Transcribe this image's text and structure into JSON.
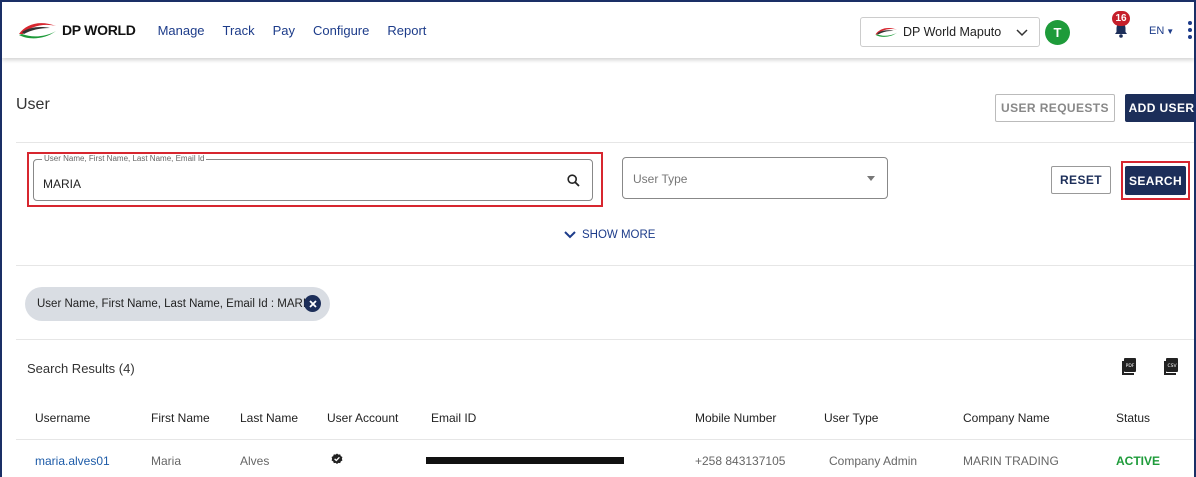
{
  "brand": {
    "logo_text": "DP WORLD",
    "accent": "#1c2e59",
    "logo_red": "#d7262f",
    "logo_green": "#1e9b3a"
  },
  "nav": {
    "items": [
      "Manage",
      "Track",
      "Pay",
      "Configure",
      "Report"
    ]
  },
  "header": {
    "site_select": "DP World Maputo",
    "avatar_initial": "T",
    "notification_count": "16",
    "language": "EN"
  },
  "page": {
    "title": "User",
    "user_requests_label": "USER REQUESTS",
    "add_user_label": "ADD USER"
  },
  "search": {
    "field_label": "User Name, First Name, Last Name, Email Id",
    "field_value": "MARIA",
    "user_type_placeholder": "User Type",
    "reset_label": "RESET",
    "search_label": "SEARCH",
    "show_more_label": "SHOW MORE"
  },
  "filter_chip": {
    "text": "User Name, First Name, Last Name, Email Id : MARIA"
  },
  "results": {
    "title": "Search Results (4)",
    "columns": [
      "Username",
      "First Name",
      "Last Name",
      "User Account",
      "Email ID",
      "Mobile Number",
      "User Type",
      "Company Name",
      "Status"
    ],
    "rows": [
      {
        "username": "maria.alves01",
        "first_name": "Maria",
        "last_name": "Alves",
        "mobile": "+258 843137105",
        "user_type": "Company Admin",
        "company": "MARIN TRADING",
        "status": "ACTIVE"
      }
    ]
  }
}
